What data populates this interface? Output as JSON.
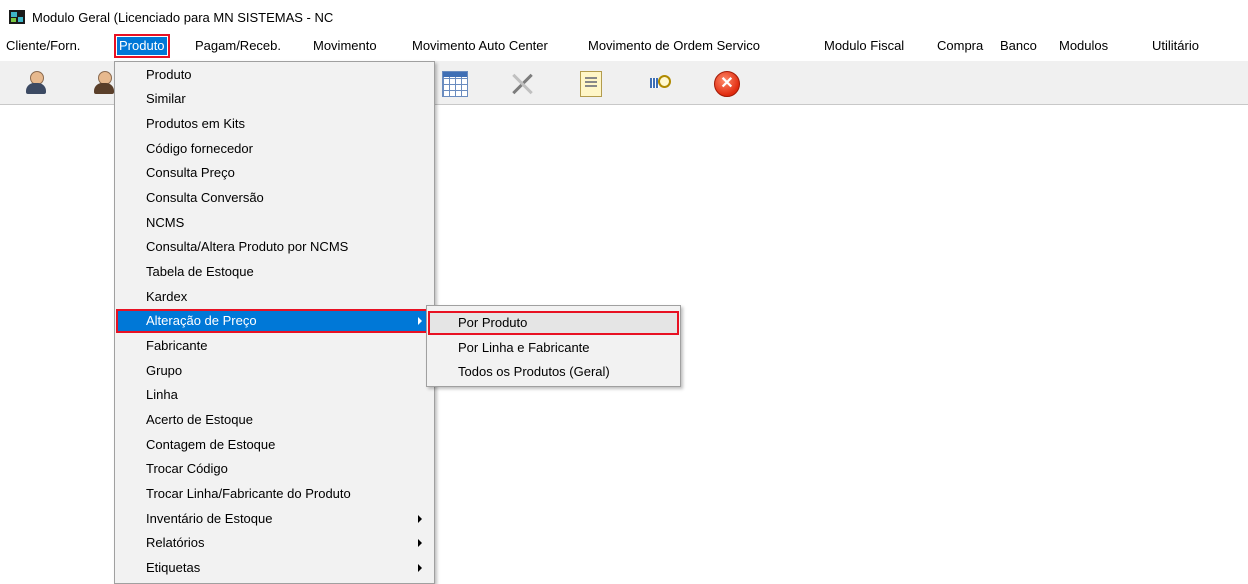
{
  "window": {
    "title": "Modulo Geral (Licenciado para MN SISTEMAS - NC"
  },
  "menubar": [
    "Cliente/Forn.",
    "Produto",
    "Pagam/Receb.",
    "Movimento",
    "Movimento Auto Center",
    "Movimento de Ordem Servico",
    "Modulo Fiscal",
    "Compra",
    "Banco",
    "Modulos",
    "Utilitário"
  ],
  "toolbar": {
    "icons": [
      "customer-icon",
      "supplier-icon",
      "grid-icon",
      "tools-icon",
      "document-icon",
      "search-report-icon",
      "close-icon"
    ],
    "close_glyph": "✕"
  },
  "produto_menu": [
    {
      "label": "Produto"
    },
    {
      "label": "Similar"
    },
    {
      "label": "Produtos em Kits"
    },
    {
      "label": "Código fornecedor"
    },
    {
      "label": "Consulta Preço"
    },
    {
      "label": "Consulta Conversão"
    },
    {
      "label": "NCMS"
    },
    {
      "label": "Consulta/Altera Produto por NCMS"
    },
    {
      "label": "Tabela de Estoque"
    },
    {
      "label": "Kardex"
    },
    {
      "label": "Alteração de Preço",
      "submenu": true,
      "highlighted": true
    },
    {
      "label": "Fabricante"
    },
    {
      "label": "Grupo"
    },
    {
      "label": "Linha"
    },
    {
      "label": "Acerto de Estoque"
    },
    {
      "label": "Contagem de Estoque"
    },
    {
      "label": "Trocar Código"
    },
    {
      "label": "Trocar Linha/Fabricante do Produto"
    },
    {
      "label": "Inventário de Estoque",
      "submenu": true
    },
    {
      "label": "Relatórios",
      "submenu": true
    },
    {
      "label": "Etiquetas",
      "submenu": true
    }
  ],
  "alteracao_preco_submenu": [
    {
      "label": "Por Produto",
      "selected": true
    },
    {
      "label": "Por Linha e Fabricante"
    },
    {
      "label": "Todos os Produtos (Geral)"
    }
  ],
  "colors": {
    "highlight": "#0078d7",
    "annotation": "#e81123",
    "toolbar": "#f0f0f0",
    "menu": "#f2f2f2"
  }
}
